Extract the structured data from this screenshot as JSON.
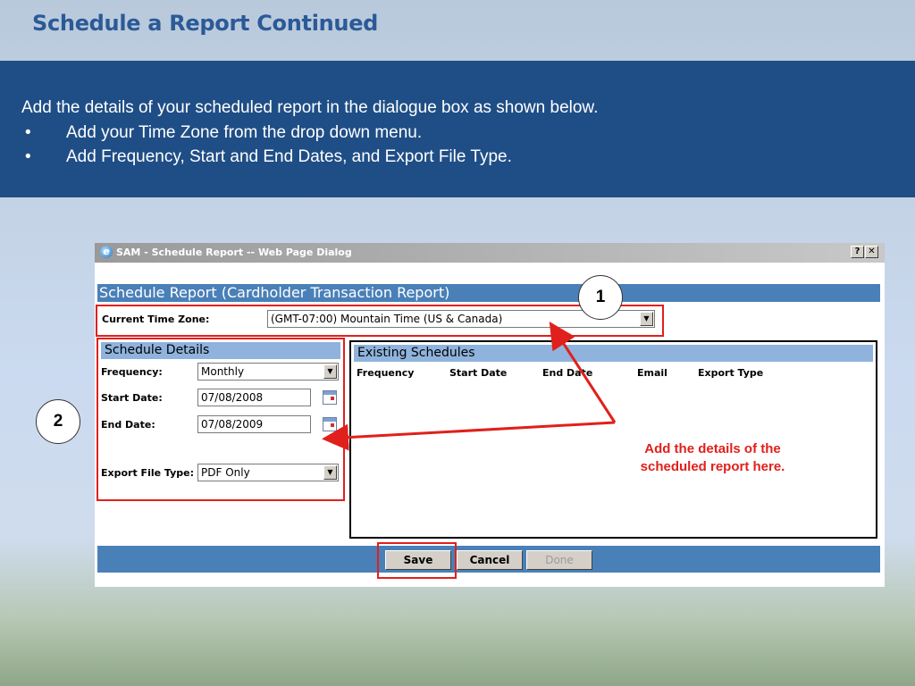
{
  "slide": {
    "title": "Schedule a Report Continued",
    "intro": "Add the details of your scheduled report in the dialogue box as shown below.",
    "bullet_symbol": "•",
    "bullets": [
      "Add your Time Zone from the drop down menu.",
      "Add Frequency, Start and End Dates, and Export File Type."
    ]
  },
  "dialog": {
    "window_title": "SAM - Schedule Report -- Web Page Dialog",
    "help_button": "?",
    "close_button": "✕",
    "report_header": "Schedule Report (Cardholder Transaction Report)",
    "time_zone_label": "Current Time Zone:",
    "time_zone_value": "(GMT-07:00) Mountain Time (US & Canada)",
    "schedule_details_header": "Schedule Details",
    "frequency_label": "Frequency:",
    "frequency_value": "Monthly",
    "start_date_label": "Start Date:",
    "start_date_value": "07/08/2008",
    "end_date_label": "End Date:",
    "end_date_value": "07/08/2009",
    "export_label": "Export File Type:",
    "export_value": "PDF Only",
    "existing_header": "Existing Schedules",
    "columns": [
      "Frequency",
      "Start Date",
      "End Date",
      "Email",
      "Export Type"
    ],
    "buttons": {
      "save": "Save",
      "cancel": "Cancel",
      "done": "Done"
    }
  },
  "annotations": {
    "badge_1": "1",
    "badge_2": "2",
    "callout": "Add the details of the scheduled report here.",
    "highlight_color": "#e0201c"
  },
  "icons": [
    "ie-icon",
    "help-icon",
    "close-icon",
    "dropdown-arrow-icon",
    "calendar-icon"
  ],
  "colors": {
    "banner": "#1f4e86",
    "title": "#2b5a96",
    "dialog_header": "#4a80b8",
    "panel_header": "#8fb3dc"
  }
}
